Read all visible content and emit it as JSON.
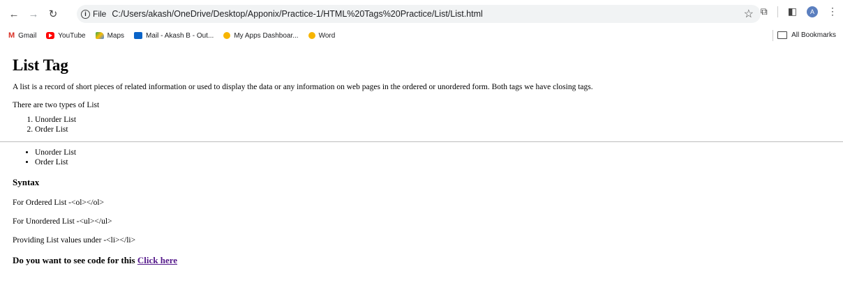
{
  "browser": {
    "url": "C:/Users/akash/OneDrive/Desktop/Apponix/Practice-1/HTML%20Tags%20Practice/List/List.html",
    "site_chip": "File",
    "avatar_letter": "A",
    "bookmarks": [
      {
        "label": "Gmail",
        "icon": "gmail-icon"
      },
      {
        "label": "YouTube",
        "icon": "youtube-icon"
      },
      {
        "label": "Maps",
        "icon": "maps-icon"
      },
      {
        "label": "Mail - Akash B - Out...",
        "icon": "outlook-icon"
      },
      {
        "label": "My Apps Dashboar...",
        "icon": "apps-dashboard-icon"
      },
      {
        "label": "Word",
        "icon": "word-icon"
      }
    ],
    "all_bookmarks": "All Bookmarks"
  },
  "page": {
    "title": "List Tag",
    "intro": "A list is a record of short pieces of related information or used to display the data or any information on web pages in the ordered or unordered form. Both tags we have closing tags.",
    "types_text": "There are two types of List",
    "ordered_items": [
      "Unorder List",
      "Order List"
    ],
    "unordered_items": [
      "Unorder List",
      "Order List"
    ],
    "syntax_heading": "Syntax",
    "syntax_lines": [
      "For Ordered List -<ol></ol>",
      "For Unordered List -<ul></ul>",
      "Providing List values under -<li></li>"
    ],
    "final_prefix": "Do you want to see code for this ",
    "final_link": "Click here"
  }
}
